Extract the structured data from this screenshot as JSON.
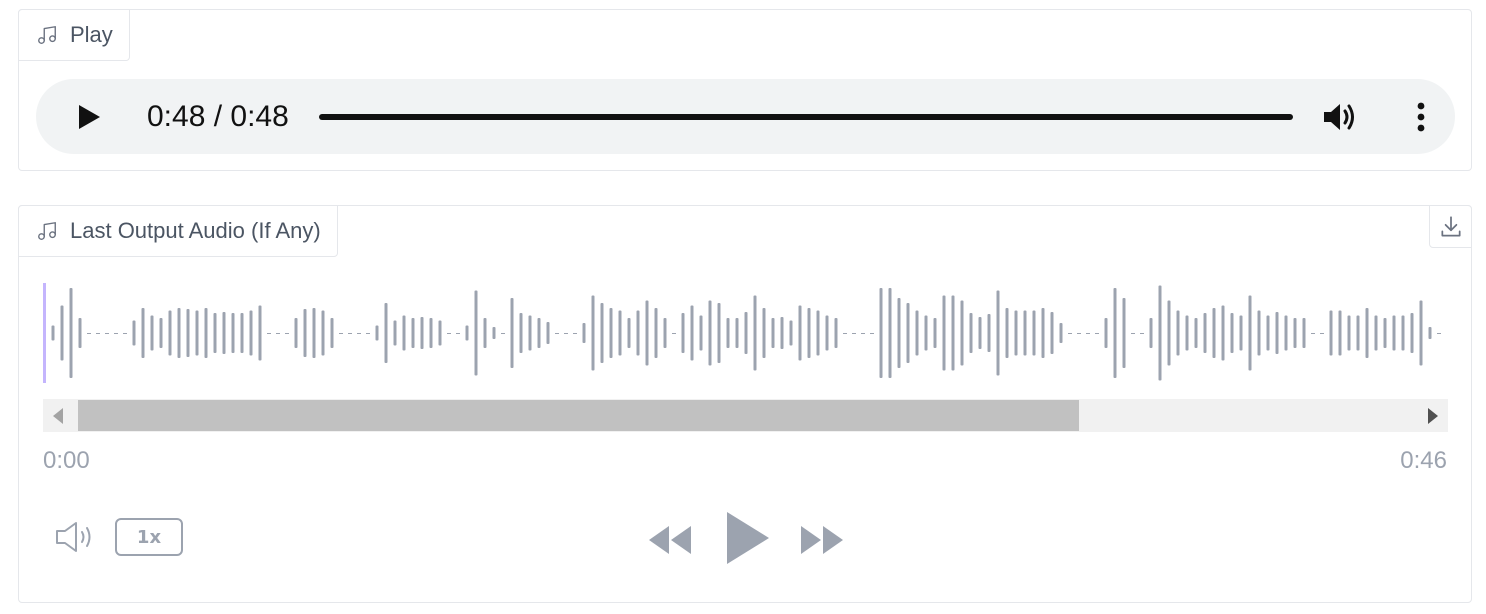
{
  "input_audio": {
    "label": "Play",
    "icon": "music-note-icon",
    "player": {
      "time_display": "0:48 / 0:48",
      "progress": 1.0
    }
  },
  "output_audio": {
    "label": "Last Output Audio (If Any)",
    "icon": "music-note-icon",
    "time_start": "0:00",
    "time_end": "0:46",
    "playback_rate": "1x",
    "scroll_fraction": 0.75,
    "waveform_color": "#9ca3af",
    "waveform": [
      0.15,
      0.55,
      0.9,
      0.3,
      0,
      0,
      0,
      0,
      0,
      0.25,
      0.5,
      0.35,
      0.3,
      0.45,
      0.5,
      0.48,
      0.45,
      0.5,
      0.4,
      0.42,
      0.4,
      0.4,
      0.45,
      0.55,
      0,
      0,
      0,
      0.3,
      0.48,
      0.5,
      0.45,
      0.3,
      0,
      0,
      0,
      0,
      0.15,
      0.6,
      0.25,
      0.35,
      0.3,
      0.32,
      0.3,
      0.25,
      0,
      0,
      0.15,
      0.85,
      0.3,
      0.12,
      0,
      0.7,
      0.4,
      0.35,
      0.3,
      0.22,
      0,
      0,
      0,
      0.2,
      0.75,
      0.6,
      0.5,
      0.45,
      0.3,
      0.45,
      0.65,
      0.5,
      0.3,
      0,
      0.4,
      0.55,
      0.35,
      0.65,
      0.6,
      0.3,
      0.3,
      0.42,
      0.75,
      0.5,
      0.3,
      0.32,
      0.25,
      0.55,
      0.5,
      0.45,
      0.35,
      0.3,
      0,
      0,
      0,
      0,
      0.9,
      0.9,
      0.7,
      0.6,
      0.45,
      0.35,
      0.3,
      0.75,
      0.75,
      0.65,
      0.4,
      0.32,
      0.38,
      0.85,
      0.5,
      0.45,
      0.45,
      0.45,
      0.5,
      0.42,
      0.2,
      0,
      0,
      0,
      0,
      0.3,
      0.9,
      0.7,
      0,
      0,
      0.3,
      0.95,
      0.65,
      0.45,
      0.35,
      0.3,
      0.4,
      0.5,
      0.55,
      0.4,
      0.35,
      0.75,
      0.45,
      0.35,
      0.42,
      0.35,
      0.3,
      0.3,
      0,
      0,
      0.45,
      0.45,
      0.35,
      0.35,
      0.5,
      0.35,
      0.3,
      0.35,
      0.35,
      0.4,
      0.65,
      0.12,
      0
    ]
  }
}
